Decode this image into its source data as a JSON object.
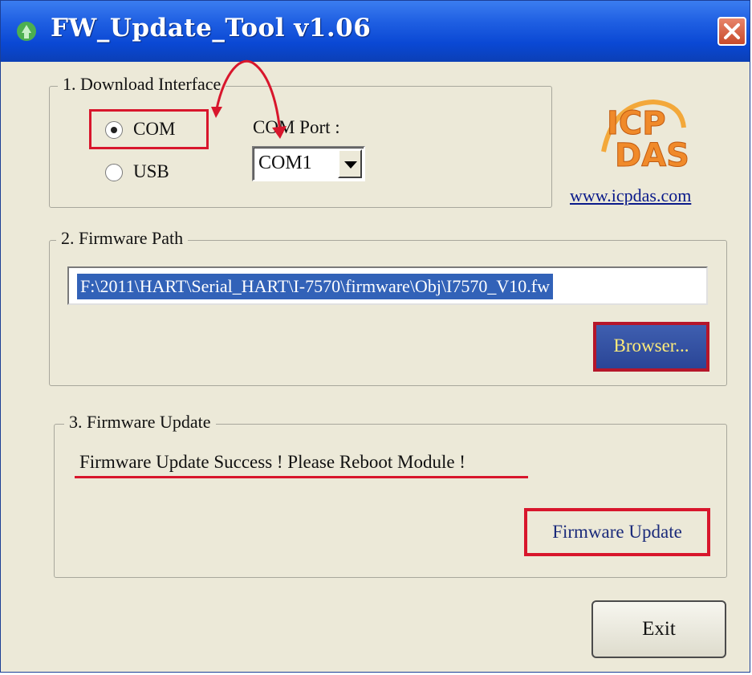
{
  "window": {
    "title": "FW_Update_Tool v1.06",
    "accent": "#0a48d4",
    "highlight_color": "#d8162c"
  },
  "download_interface": {
    "legend": "1. Download Interface",
    "radio_com_label": "COM",
    "radio_usb_label": "USB",
    "selected": "COM",
    "com_port_label": "COM Port :",
    "com_port_value": "COM1"
  },
  "brand": {
    "logo_text_top": "ICP",
    "logo_text_bottom": "DAS",
    "link": "www.icpdas.com"
  },
  "firmware_path": {
    "legend": "2. Firmware Path",
    "path_value": "F:\\2011\\HART\\Serial_HART\\I-7570\\firmware\\Obj\\I7570_V10.fw",
    "browser_label": "Browser..."
  },
  "firmware_update": {
    "legend": "3. Firmware Update",
    "status": "Firmware Update Success !  Please Reboot Module !",
    "update_label": "Firmware Update"
  },
  "footer": {
    "exit_label": "Exit"
  }
}
